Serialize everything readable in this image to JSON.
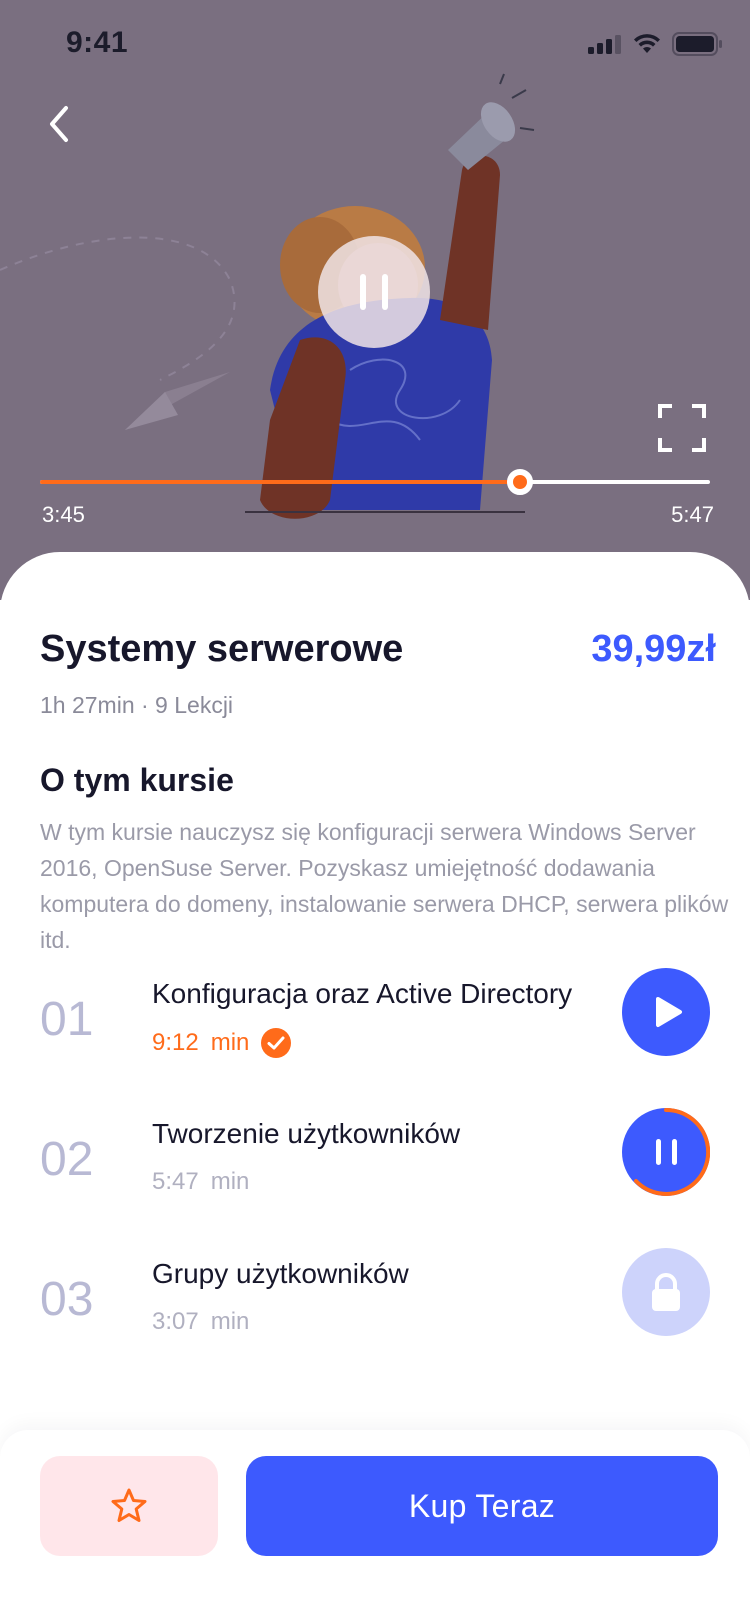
{
  "colors": {
    "accent": "#3d5afe",
    "orange": "#ff6b1a",
    "video_bg": "#7a6f80",
    "locked": "#cdd3fb",
    "favorite_bg": "#ffe6ea"
  },
  "status_bar": {
    "time": "9:41"
  },
  "video": {
    "current_time": "3:45",
    "total_time": "5:47",
    "progress_fraction": 0.716
  },
  "course": {
    "title": "Systemy serwerowe",
    "price": "39,99zł",
    "meta": "1h 27min · 9 Lekcji",
    "about_heading": "O tym kursie",
    "about_text": "W tym kursie nauczysz się konfiguracji serwera Windows Server 2016, OpenSuse Server. Pozyskasz umiejętność dodawania komputera do domeny, instalowanie serwera DHCP, serwera plików itd."
  },
  "lessons": [
    {
      "number": "01",
      "title": "Konfiguracja oraz Active Directory",
      "duration": "9:12",
      "unit": "min",
      "state": "completed",
      "icon": "play-icon"
    },
    {
      "number": "02",
      "title": "Tworzenie użytkowników",
      "duration": "5:47",
      "unit": "min",
      "state": "playing",
      "icon": "pause-icon"
    },
    {
      "number": "03",
      "title": "Grupy użytkowników",
      "duration": "3:07",
      "unit": "min",
      "state": "locked",
      "icon": "lock-icon"
    }
  ],
  "actions": {
    "buy_label": "Kup Teraz",
    "favorite_icon": "star-icon"
  }
}
